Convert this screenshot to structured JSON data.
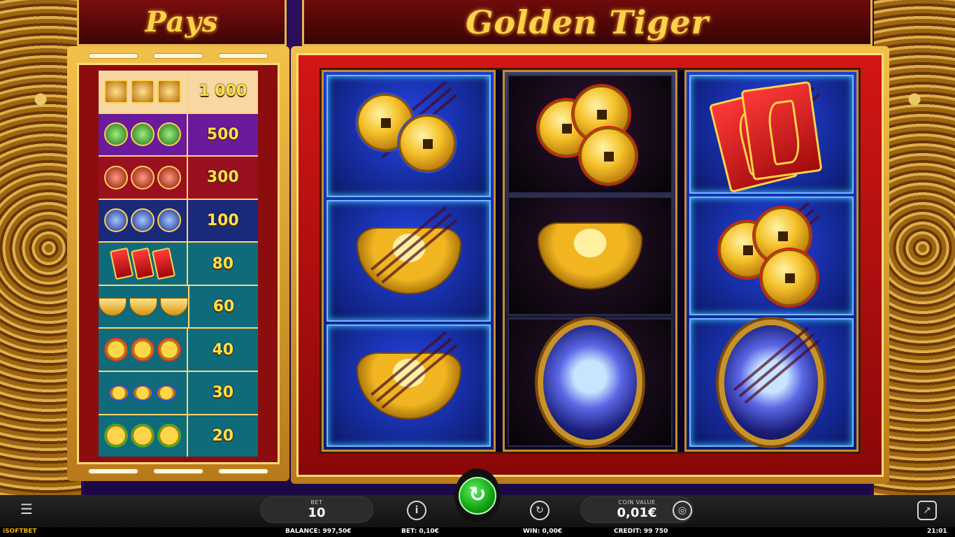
{
  "game": {
    "title": "Golden Tiger",
    "pays_title": "Pays"
  },
  "paytable": [
    {
      "symbol": "gold-tiger",
      "value": "1 000"
    },
    {
      "symbol": "green-tiger",
      "value": "500"
    },
    {
      "symbol": "red-tiger",
      "value": "300"
    },
    {
      "symbol": "blue-tiger",
      "value": "100"
    },
    {
      "symbol": "envelope",
      "value": "80"
    },
    {
      "symbol": "ingot",
      "value": "60"
    },
    {
      "symbol": "coins-red",
      "value": "40"
    },
    {
      "symbol": "coins-blue",
      "value": "30"
    },
    {
      "symbol": "coin-green",
      "value": "20"
    }
  ],
  "reels": [
    [
      "coins-blue",
      "ingot",
      "ingot"
    ],
    [
      "coins-red",
      "ingot",
      "tiger-blue"
    ],
    [
      "envelope",
      "coins-red",
      "tiger-blue"
    ]
  ],
  "controls": {
    "bet_label": "BET",
    "bet_value": "10",
    "coin_value_label": "COIN VALUE",
    "coin_value": "0,01€",
    "spin_icon": "spin-arrow-icon"
  },
  "status": {
    "brand": "iSOFTBET",
    "balance": "BALANCE: 997,50€",
    "bet": "BET: 0,10€",
    "win": "WIN: 0,00€",
    "credit": "CREDIT: 99 750",
    "time": "21:01"
  }
}
